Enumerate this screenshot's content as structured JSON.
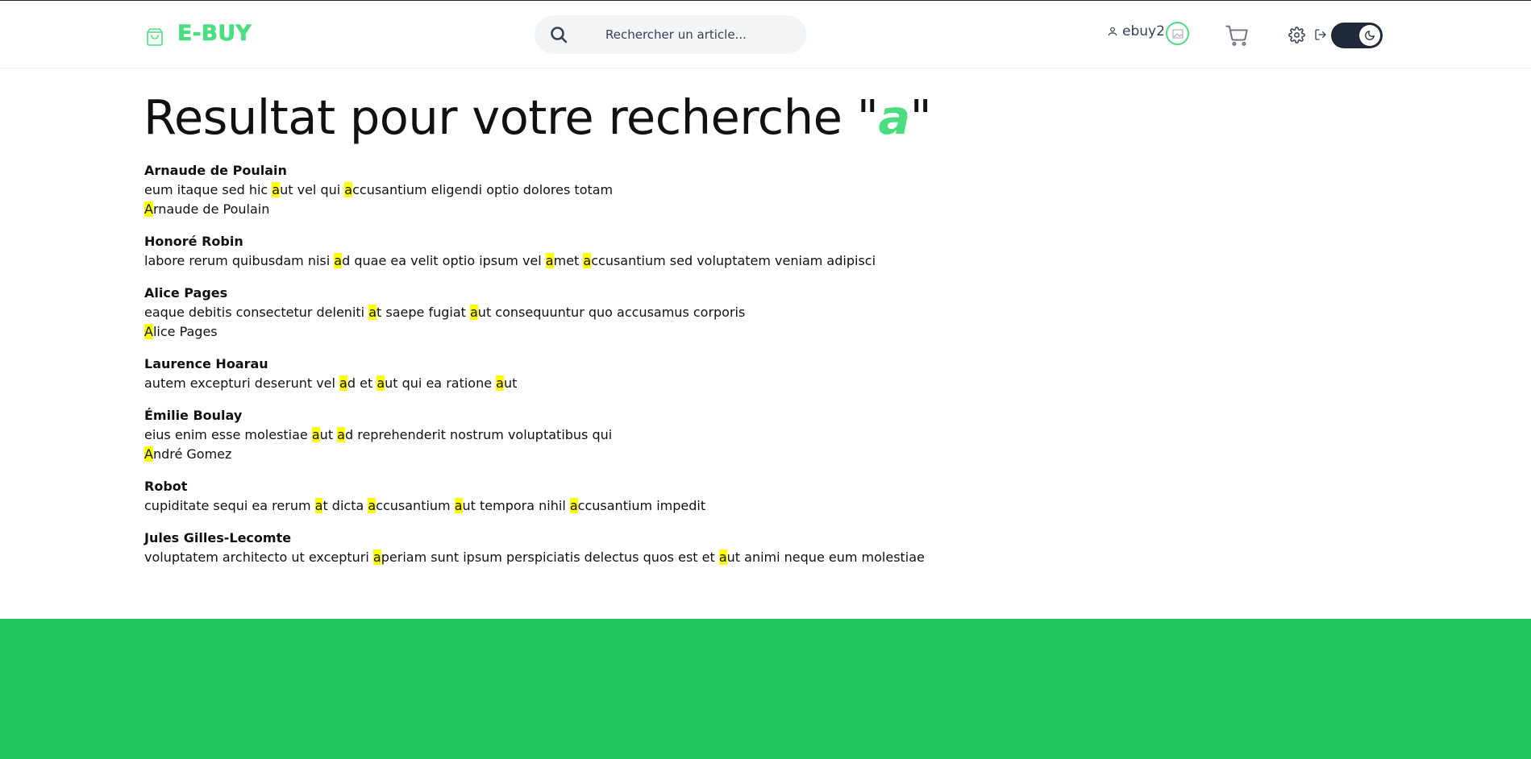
{
  "header": {
    "brand": "E-BUY",
    "search_placeholder": "Rechercher un article...",
    "username": "ebuy2",
    "icons": [
      "shopping-bag-icon",
      "search-icon",
      "user-icon",
      "avatar",
      "cart-icon",
      "gear-icon",
      "logout-icon",
      "moon-icon"
    ]
  },
  "title": {
    "prefix": "Resultat pour votre recherche \"",
    "query": "a",
    "suffix": "\""
  },
  "highlight_color": "#ffff00",
  "accent_color": "#4ade80",
  "footer_color": "#22c55e",
  "results": [
    {
      "author": "Arnaude de Poulain",
      "lines": [
        [
          "eum itaque sed hic ",
          {
            "m": "a"
          },
          "ut vel qui ",
          {
            "m": "a"
          },
          "ccusantium eligendi optio dolores totam"
        ],
        [
          {
            "m": "A"
          },
          "rnaude de Poulain"
        ]
      ]
    },
    {
      "author": "Honoré Robin",
      "lines": [
        [
          "labore rerum quibusdam nisi ",
          {
            "m": "a"
          },
          "d quae ea velit optio ipsum vel ",
          {
            "m": "a"
          },
          "met ",
          {
            "m": "a"
          },
          "ccusantium sed voluptatem veniam adipisci"
        ]
      ]
    },
    {
      "author": "Alice Pages",
      "lines": [
        [
          "eaque debitis consectetur deleniti ",
          {
            "m": "a"
          },
          "t saepe fugiat ",
          {
            "m": "a"
          },
          "ut consequuntur quo accusamus corporis"
        ],
        [
          {
            "m": "A"
          },
          "lice Pages"
        ]
      ]
    },
    {
      "author": "Laurence Hoarau",
      "lines": [
        [
          "autem excepturi deserunt vel ",
          {
            "m": "a"
          },
          "d et ",
          {
            "m": "a"
          },
          "ut qui ea ratione ",
          {
            "m": "a"
          },
          "ut"
        ]
      ]
    },
    {
      "author": "Émilie Boulay",
      "lines": [
        [
          "eius enim esse molestiae ",
          {
            "m": "a"
          },
          "ut ",
          {
            "m": "a"
          },
          "d reprehenderit nostrum voluptatibus qui"
        ],
        [
          {
            "m": "A"
          },
          "ndré Gomez"
        ]
      ]
    },
    {
      "author": "Robot",
      "lines": [
        [
          "cupiditate sequi ea rerum ",
          {
            "m": "a"
          },
          "t dicta ",
          {
            "m": "a"
          },
          "ccusantium ",
          {
            "m": "a"
          },
          "ut tempora nihil ",
          {
            "m": "a"
          },
          "ccusantium impedit"
        ]
      ]
    },
    {
      "author": "Jules Gilles-Lecomte",
      "lines": [
        [
          "voluptatem architecto ut excepturi ",
          {
            "m": "a"
          },
          "periam sunt ipsum perspiciatis delectus quos est et ",
          {
            "m": "a"
          },
          "ut animi neque eum molestiae"
        ]
      ]
    }
  ]
}
